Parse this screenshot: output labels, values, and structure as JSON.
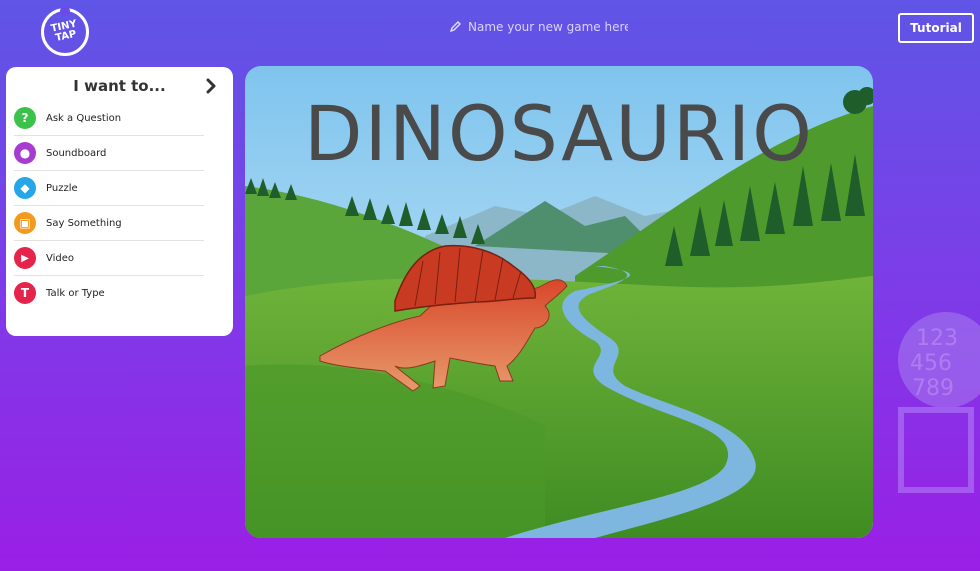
{
  "header": {
    "logo_text": "TINY TAP",
    "game_name_placeholder": "Name your new game here",
    "tutorial_label": "Tutorial"
  },
  "panel": {
    "title": "I want to...",
    "items": [
      {
        "label": "Ask a Question",
        "icon": "question-icon",
        "color": "#3cc24a",
        "glyph": "?"
      },
      {
        "label": "Soundboard",
        "icon": "soundboard-icon",
        "color": "#a83bd0",
        "glyph": "●"
      },
      {
        "label": "Puzzle",
        "icon": "puzzle-icon",
        "color": "#25a6e8",
        "glyph": "◆"
      },
      {
        "label": "Say Something",
        "icon": "book-icon",
        "color": "#f39a1e",
        "glyph": "▣"
      },
      {
        "label": "Video",
        "icon": "play-icon",
        "color": "#e5234b",
        "glyph": "▶"
      },
      {
        "label": "Talk or Type",
        "icon": "talk-type-icon",
        "color": "#e5234b",
        "glyph": "T"
      }
    ]
  },
  "stage": {
    "title": "DINOSAURIO"
  },
  "colors": {
    "bg_top": "#5f55e6",
    "bg_bottom": "#9a1fe6"
  }
}
